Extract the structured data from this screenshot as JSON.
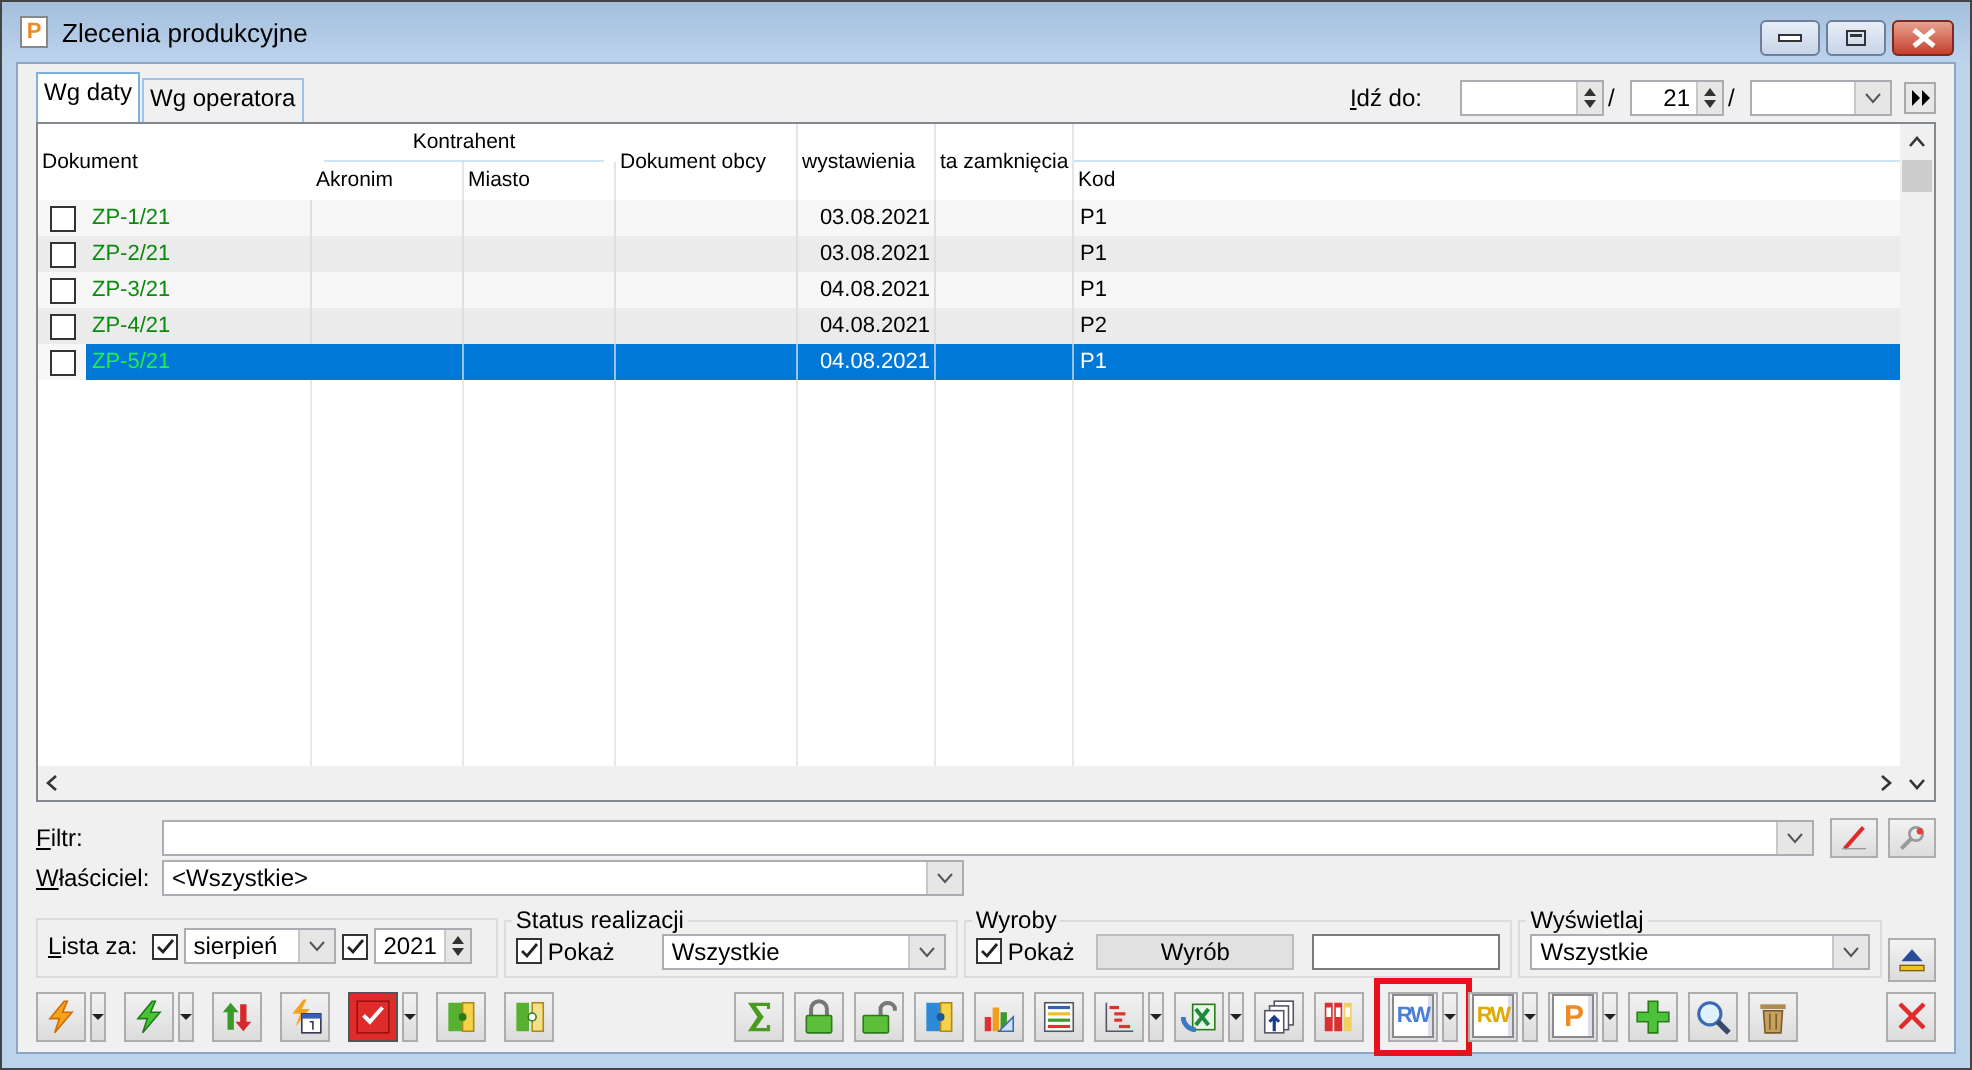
{
  "window": {
    "icon_letter": "P",
    "title": "Zlecenia produkcyjne"
  },
  "tabs": [
    {
      "label": "Wg daty",
      "selected": true
    },
    {
      "label": "Wg operatora",
      "selected": false
    }
  ],
  "go_to": {
    "label": "Idź do:",
    "separators": [
      "/",
      "/"
    ],
    "field_2": "21"
  },
  "table": {
    "header": [
      {
        "label": "Dokument"
      },
      {
        "label": "Kontrahent",
        "children": [
          {
            "label": "Akronim"
          },
          {
            "label": "Miasto"
          }
        ]
      },
      {
        "label": "Dokument obcy"
      },
      {
        "label": "wystawienia"
      },
      {
        "label": "ta zamknięcia"
      },
      {
        "children": [
          {
            "label": "Kod"
          }
        ]
      }
    ],
    "rows": [
      {
        "checked": false,
        "selected": false,
        "dokument": "ZP-1/21",
        "wystawienia": "03.08.2021",
        "kod": "P1"
      },
      {
        "checked": false,
        "selected": false,
        "dokument": "ZP-2/21",
        "wystawienia": "03.08.2021",
        "kod": "P1"
      },
      {
        "checked": false,
        "selected": false,
        "dokument": "ZP-3/21",
        "wystawienia": "04.08.2021",
        "kod": "P1"
      },
      {
        "checked": false,
        "selected": false,
        "dokument": "ZP-4/21",
        "wystawienia": "04.08.2021",
        "kod": "P2"
      },
      {
        "checked": false,
        "selected": true,
        "dokument": "ZP-5/21",
        "wystawienia": "04.08.2021",
        "kod": "P1"
      }
    ]
  },
  "filter": {
    "label": "Filtr:"
  },
  "owner": {
    "label": "Właściciel:",
    "value": "<Wszystkie>"
  },
  "list_for": {
    "label": "Lista za:",
    "month_checked": true,
    "month": "sierpień",
    "year_checked": true,
    "year": "2021"
  },
  "status": {
    "title": "Status realizacji",
    "show_checked": true,
    "show_label": "Pokaż",
    "value": "Wszystkie"
  },
  "products": {
    "title": "Wyroby",
    "show_checked": true,
    "show_label": "Pokaż",
    "button": "Wyrób"
  },
  "display": {
    "title": "Wyświetlaj",
    "value": "Wszystkie"
  },
  "toolbar": {
    "left": [
      {
        "kind": "bolt-orange",
        "dropdown": true
      },
      {
        "kind": "bolt-green",
        "dropdown": true
      },
      {
        "kind": "arrows",
        "dropdown": false
      },
      {
        "kind": "bolt-calendar",
        "dropdown": false
      },
      {
        "kind": "check-red",
        "dropdown": true
      },
      {
        "kind": "door-in",
        "dropdown": false
      },
      {
        "kind": "door-out",
        "dropdown": false
      }
    ],
    "right": [
      {
        "kind": "sigma",
        "dropdown": false,
        "highlighted": false
      },
      {
        "kind": "lock",
        "dropdown": false,
        "highlighted": false
      },
      {
        "kind": "lock-open",
        "dropdown": false,
        "highlighted": false
      },
      {
        "kind": "door-blue",
        "dropdown": false,
        "highlighted": false
      },
      {
        "kind": "chart",
        "dropdown": false,
        "highlighted": false
      },
      {
        "kind": "list",
        "dropdown": false,
        "highlighted": false
      },
      {
        "kind": "tree",
        "dropdown": true,
        "highlighted": false
      },
      {
        "kind": "excel",
        "dropdown": true,
        "highlighted": false
      },
      {
        "kind": "pages",
        "dropdown": false,
        "highlighted": false
      },
      {
        "kind": "binders",
        "dropdown": false,
        "highlighted": false
      },
      {
        "kind": "label",
        "label": "RW",
        "color": "#4a7fd6",
        "dropdown": true,
        "highlighted": true
      },
      {
        "kind": "label",
        "label": "RW",
        "color": "#e0a800",
        "dropdown": true,
        "highlighted": false
      },
      {
        "kind": "label",
        "label": "P",
        "color": "#f08a24",
        "dropdown": true,
        "highlighted": false
      },
      {
        "kind": "plus",
        "dropdown": false,
        "highlighted": false
      },
      {
        "kind": "search",
        "dropdown": false,
        "highlighted": false
      },
      {
        "kind": "trash",
        "dropdown": false,
        "highlighted": false
      }
    ]
  }
}
